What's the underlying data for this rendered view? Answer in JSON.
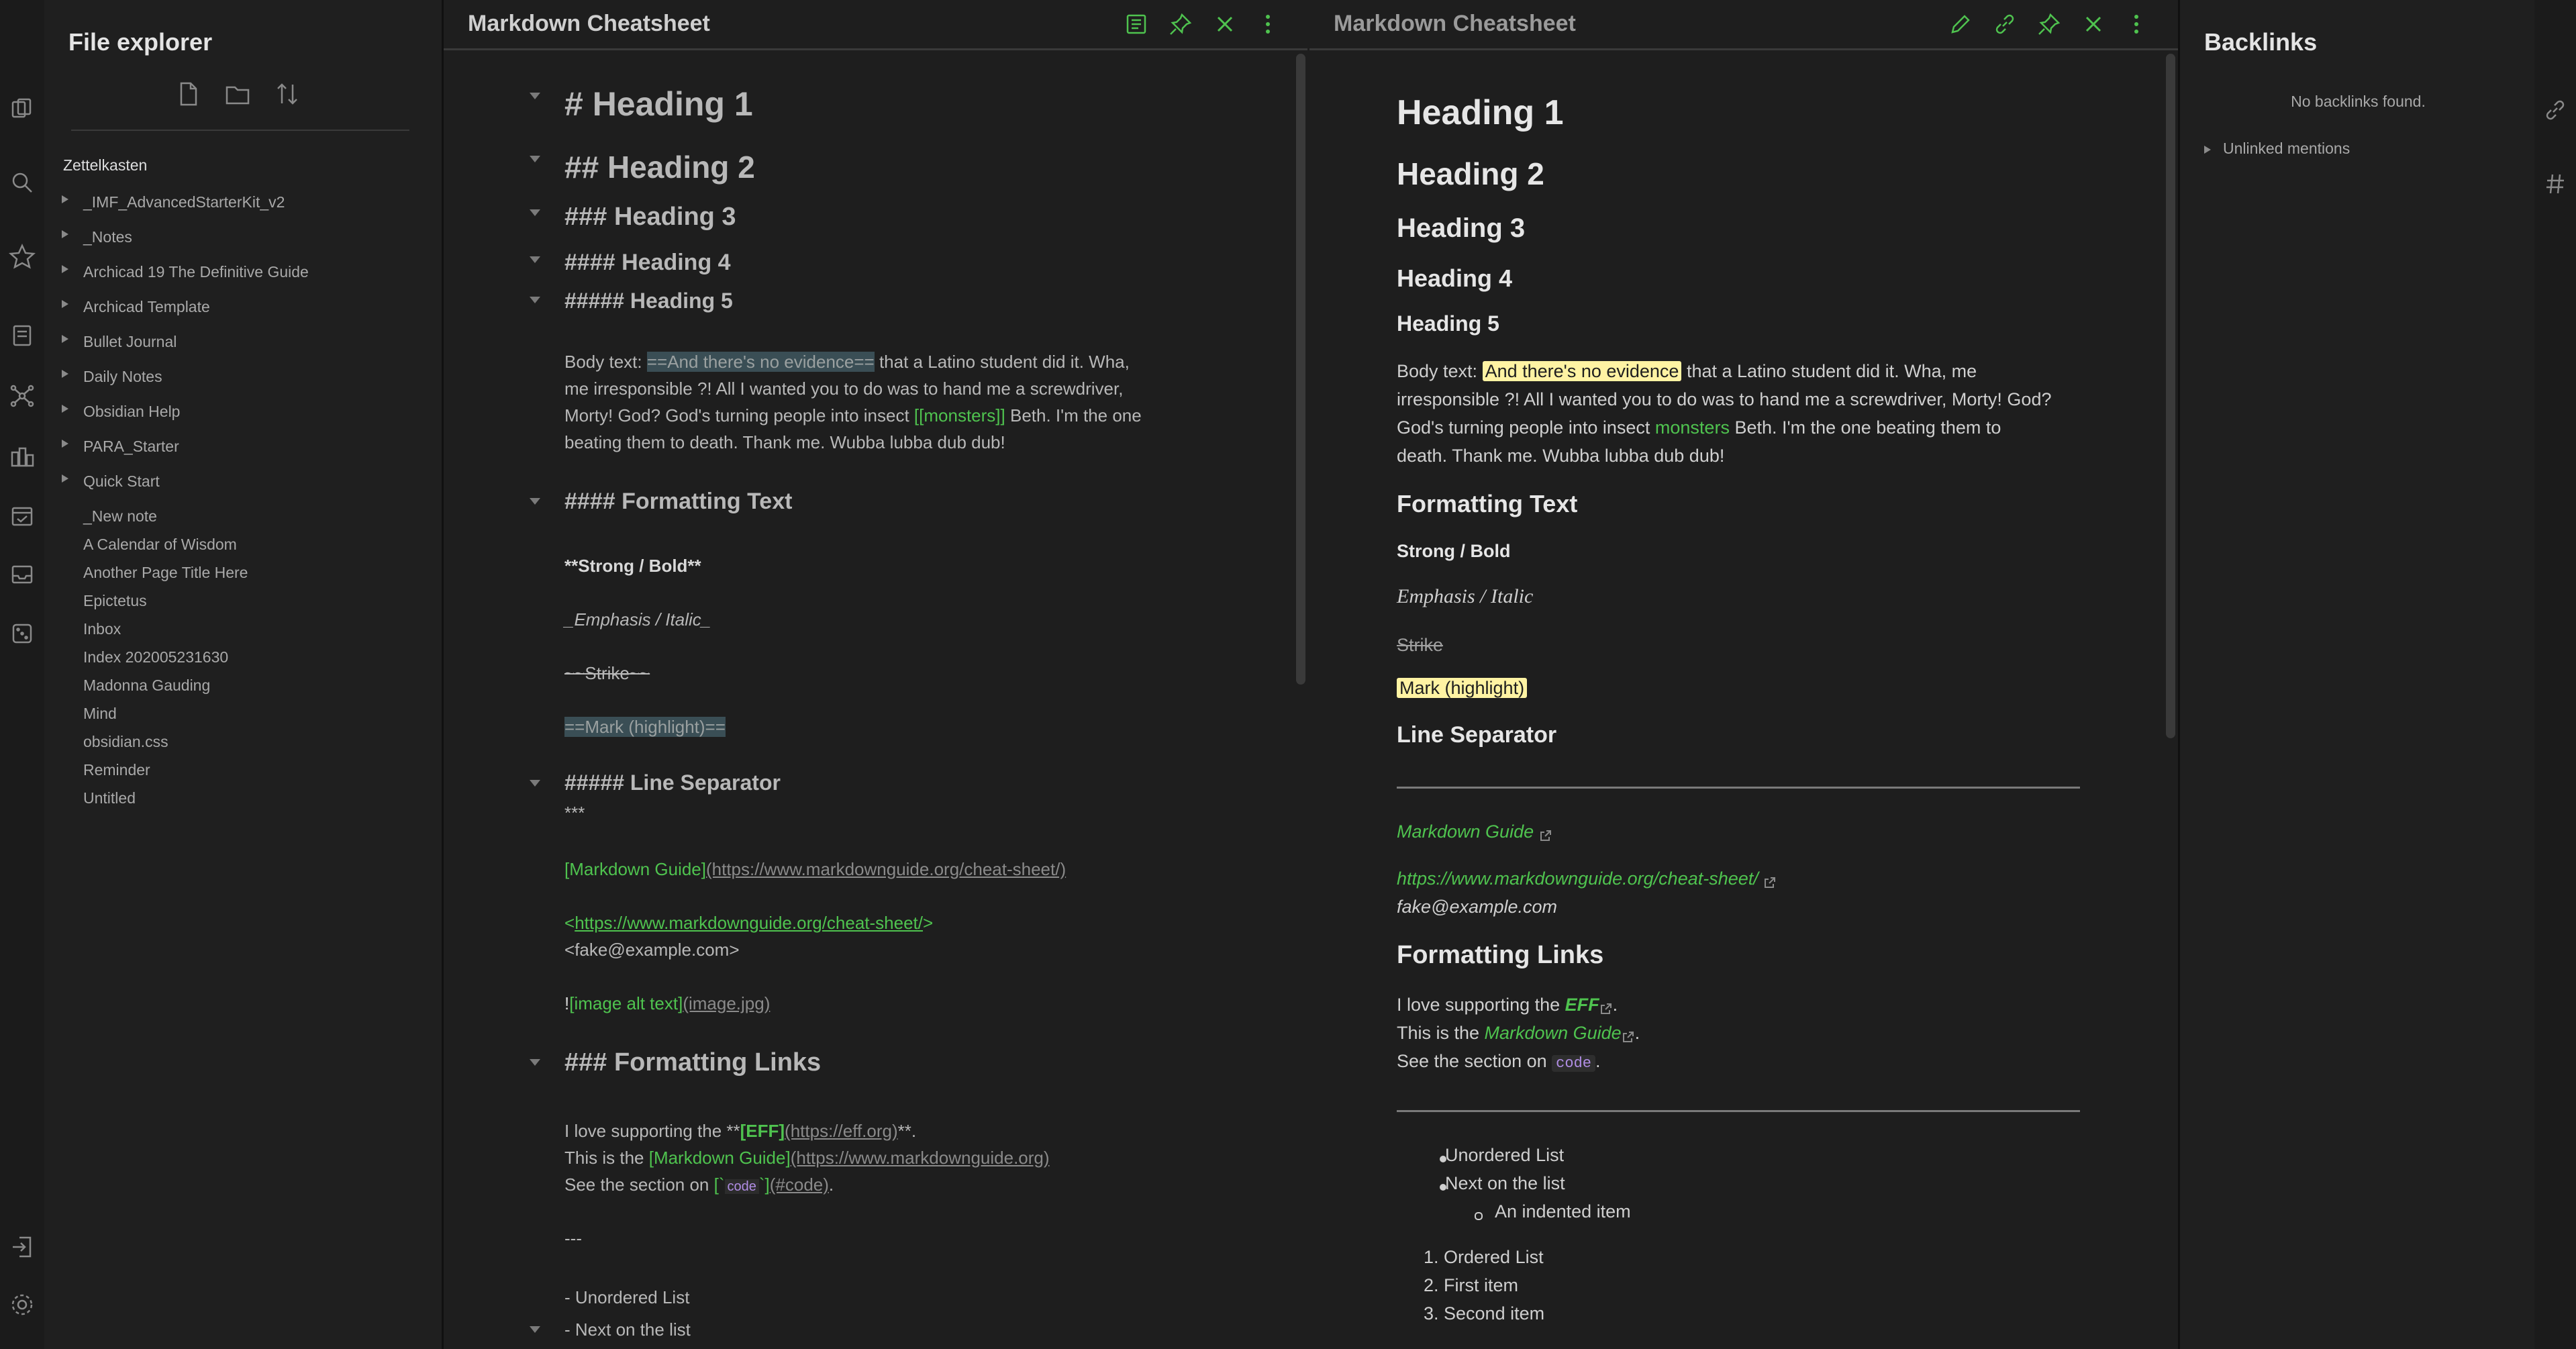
{
  "explorer": {
    "title": "File explorer",
    "vault": "Zettelkasten",
    "folders": [
      "_IMF_AdvancedStarterKit_v2",
      "_Notes",
      "Archicad 19 The Definitive Guide",
      "Archicad Template",
      "Bullet Journal",
      "Daily Notes",
      "Obsidian Help",
      "PARA_Starter",
      "Quick Start"
    ],
    "files": [
      "_New note",
      "A Calendar of Wisdom",
      "Another Page Title Here",
      "Epictetus",
      "Inbox",
      "Index 202005231630",
      "Madonna Gauding",
      "Mind",
      "obsidian.css",
      "Reminder",
      "Untitled"
    ]
  },
  "left_pane": {
    "title": "Markdown Cheatsheet",
    "h1": "# Heading 1",
    "h2": "## Heading 2",
    "h3": "### Heading 3",
    "h4": "#### Heading 4",
    "h5": "##### Heading 5",
    "body_prefix": "Body text: ",
    "body_highlight": "==And there's no evidence==",
    "body_l1_rest": " that a Latino student did it. Wha,",
    "body_l2": "me irresponsible ?! All I wanted you to do was to hand me a screwdriver,",
    "body_l3_a": "Morty! God? God's turning people into insect ",
    "body_l3_link": "[[monsters]]",
    "body_l3_b": " Beth. I'm the one",
    "body_l4": "beating them to death. Thank me. Wubba lubba dub dub!",
    "fmt_heading": "#### Formatting Text",
    "strong": "**Strong / Bold**",
    "emphasis": "_Emphasis / Italic_",
    "strike": "~~Strike~~",
    "mark": "==Mark (highlight)==",
    "sep_heading": "##### Line Separator",
    "sep": "***",
    "mdlink_text": "[Markdown Guide]",
    "mdlink_url": "(https://www.markdownguide.org/cheat-sheet/)",
    "auto_lt": "<",
    "auto_url": "https://www.markdownguide.org/cheat-sheet/",
    "auto_gt": ">",
    "auto_email": "<fake@example.com>",
    "img_bang": "!",
    "img_alt": "[image alt text]",
    "img_src": "(image.jpg)",
    "links_heading": "### Formatting Links",
    "love_a": "I love supporting the **",
    "love_link": "[EFF]",
    "love_url": "(https://eff.org)",
    "love_b": "**.",
    "this_a": "This is the ",
    "this_link": "[Markdown Guide]",
    "this_url": "(https://www.markdownguide.org)",
    "see_a": "See the section on ",
    "see_link_open": "[`",
    "see_code": "code",
    "see_link_close": "`]",
    "see_url": "(#code)",
    "see_b": ".",
    "hr_src": "---",
    "ul1": "- Unordered List",
    "ul2": "- Next on the list"
  },
  "right_pane": {
    "title": "Markdown Cheatsheet",
    "h1": "Heading 1",
    "h2": "Heading 2",
    "h3": "Heading 3",
    "h4": "Heading 4",
    "h5": "Heading 5",
    "body_prefix": "Body text: ",
    "body_highlight": "And there's no evidence",
    "body_l1_rest": " that a Latino student did it. Wha, me",
    "body_l2": "irresponsible ?! All I wanted you to do was to hand me a screwdriver, Morty! God?",
    "body_l3_a": "God's turning people into insect ",
    "body_l3_link": "monsters",
    "body_l3_b": " Beth. I'm the one beating them to",
    "body_l4": "death. Thank me. Wubba lubba dub dub!",
    "fmt_heading": "Formatting Text",
    "strong": "Strong / Bold",
    "emphasis": "Emphasis / Italic",
    "strike": "Strike",
    "mark": "Mark (highlight)",
    "sep_heading": "Line Separator",
    "mdlink": "Markdown Guide",
    "autolink": "https://www.markdownguide.org/cheat-sheet/",
    "email": "fake@example.com",
    "links_heading": "Formatting Links",
    "love_a": "I love supporting the ",
    "love_link": "EFF",
    "love_b": ".",
    "this_a": "This is the ",
    "this_link": "Markdown Guide",
    "this_b": ".",
    "see_a": "See the section on ",
    "see_code": "code",
    "see_b": ".",
    "ul": [
      "Unordered List",
      "Next on the list"
    ],
    "ul_nested": "An indented item",
    "ol": [
      "1. Ordered List",
      "2. First item",
      "3. Second item"
    ]
  },
  "backlinks": {
    "title": "Backlinks",
    "none": "No backlinks found.",
    "unlinked": "Unlinked mentions"
  },
  "colors": {
    "accent": "#4fc34f",
    "background": "#1e1e1e",
    "mark": "#fff3a3"
  }
}
